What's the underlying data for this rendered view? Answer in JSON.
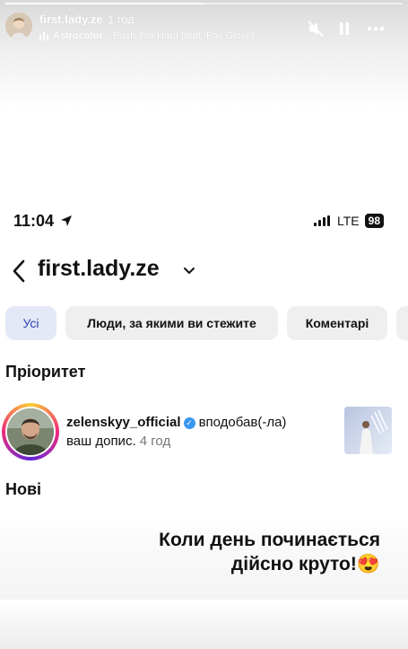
{
  "story": {
    "username": "first.lady.ze",
    "time": "1 год",
    "music_artist": "Astrocolor",
    "music_track": "· Push Too Hard (feat. Fox Glove)",
    "progress": 0.5,
    "icons": [
      "mute-icon",
      "pause-icon",
      "more-icon"
    ]
  },
  "status_bar": {
    "time": "11:04",
    "network": "LTE",
    "battery": "98"
  },
  "header": {
    "title": "first.lady.ze"
  },
  "filters": [
    "Усі",
    "Люди, за якими ви стежите",
    "Коментарі"
  ],
  "sections": {
    "priority": "Пріоритет",
    "new": "Нові"
  },
  "notification": {
    "username": "zelenskyy_official",
    "action_line1": "вподобав(-ла)",
    "action_line2": "ваш допис.",
    "time": "4 год"
  },
  "caption": {
    "line1": "Коли день починається",
    "line2": "дійсно круто!😍"
  }
}
